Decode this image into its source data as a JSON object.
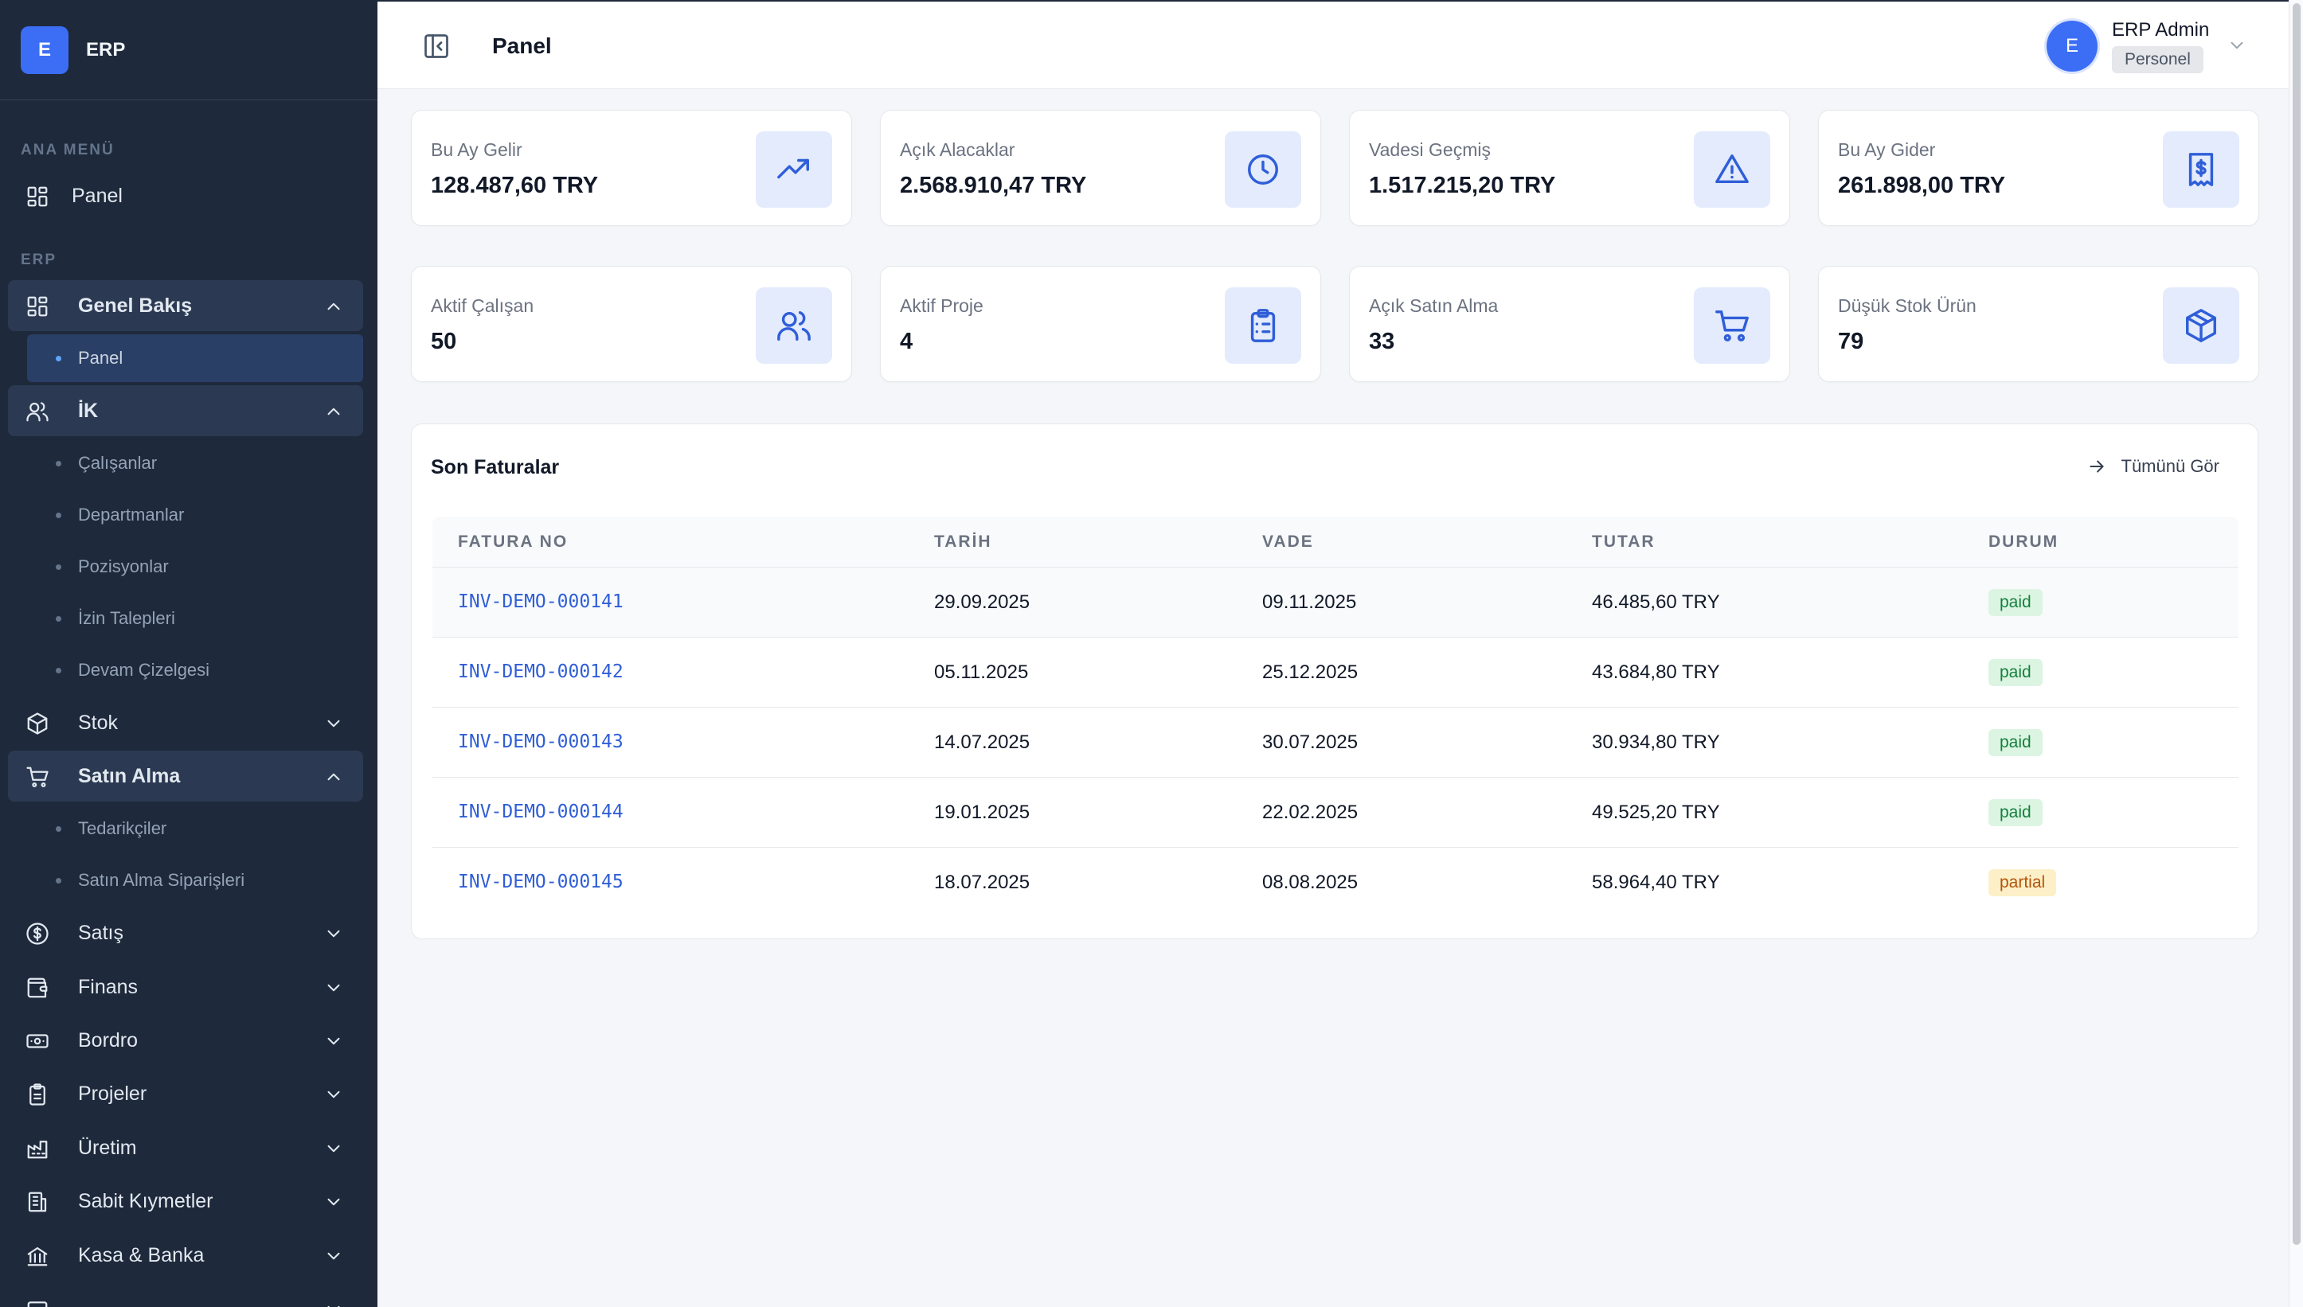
{
  "brand": {
    "logo_letter": "E",
    "name": "ERP"
  },
  "sidebar": {
    "section_main": "ANA MENÜ",
    "main_items": [
      {
        "label": "Panel",
        "icon": "grid-icon"
      }
    ],
    "section_erp": "ERP",
    "groups": [
      {
        "label": "Genel Bakış",
        "icon": "grid-icon",
        "expanded": true,
        "children": [
          "Panel"
        ],
        "active_child": "Panel"
      },
      {
        "label": "İK",
        "icon": "users-icon",
        "expanded": true,
        "children": [
          "Çalışanlar",
          "Departmanlar",
          "Pozisyonlar",
          "İzin Talepleri",
          "Devam Çizelgesi"
        ]
      },
      {
        "label": "Stok",
        "icon": "box-icon",
        "expanded": false
      },
      {
        "label": "Satın Alma",
        "icon": "cart-icon",
        "expanded": true,
        "children": [
          "Tedarikçiler",
          "Satın Alma Siparişleri"
        ]
      },
      {
        "label": "Satış",
        "icon": "dollar-icon",
        "expanded": false
      },
      {
        "label": "Finans",
        "icon": "wallet-icon",
        "expanded": false
      },
      {
        "label": "Bordro",
        "icon": "banknote-icon",
        "expanded": false
      },
      {
        "label": "Projeler",
        "icon": "clipboard-icon",
        "expanded": false
      },
      {
        "label": "Üretim",
        "icon": "factory-icon",
        "expanded": false
      },
      {
        "label": "Sabit Kıymetler",
        "icon": "building-icon",
        "expanded": false
      },
      {
        "label": "Kasa & Banka",
        "icon": "bank-icon",
        "expanded": false
      }
    ]
  },
  "header": {
    "title": "Panel",
    "user": {
      "initial": "E",
      "name": "ERP Admin",
      "role": "Personel"
    }
  },
  "stats": [
    {
      "label": "Bu Ay Gelir",
      "value": "128.487,60 TRY",
      "icon": "trending-up-icon"
    },
    {
      "label": "Açık Alacaklar",
      "value": "2.568.910,47 TRY",
      "icon": "clock-icon"
    },
    {
      "label": "Vadesi Geçmiş",
      "value": "1.517.215,20 TRY",
      "icon": "alert-triangle-icon"
    },
    {
      "label": "Bu Ay Gider",
      "value": "261.898,00 TRY",
      "icon": "receipt-icon"
    },
    {
      "label": "Aktif Çalışan",
      "value": "50",
      "icon": "users-icon"
    },
    {
      "label": "Aktif Proje",
      "value": "4",
      "icon": "clipboard-list-icon"
    },
    {
      "label": "Açık Satın Alma",
      "value": "33",
      "icon": "cart-icon"
    },
    {
      "label": "Düşük Stok Ürün",
      "value": "79",
      "icon": "package-icon"
    }
  ],
  "invoices": {
    "title": "Son Faturalar",
    "view_all": "Tümünü Gör",
    "columns": [
      "FATURA NO",
      "TARİH",
      "VADE",
      "TUTAR",
      "DURUM"
    ],
    "rows": [
      {
        "no": "INV-DEMO-000141",
        "date": "29.09.2025",
        "due": "09.11.2025",
        "amount": "46.485,60 TRY",
        "status": "paid"
      },
      {
        "no": "INV-DEMO-000142",
        "date": "05.11.2025",
        "due": "25.12.2025",
        "amount": "43.684,80 TRY",
        "status": "paid"
      },
      {
        "no": "INV-DEMO-000143",
        "date": "14.07.2025",
        "due": "30.07.2025",
        "amount": "30.934,80 TRY",
        "status": "paid"
      },
      {
        "no": "INV-DEMO-000144",
        "date": "19.01.2025",
        "due": "22.02.2025",
        "amount": "49.525,20 TRY",
        "status": "paid"
      },
      {
        "no": "INV-DEMO-000145",
        "date": "18.07.2025",
        "due": "08.08.2025",
        "amount": "58.964,40 TRY",
        "status": "partial"
      }
    ]
  },
  "colors": {
    "accent": "#3b6ef5",
    "sidebar_bg": "#1e293b",
    "paid": "#15803d",
    "partial": "#b45309"
  }
}
